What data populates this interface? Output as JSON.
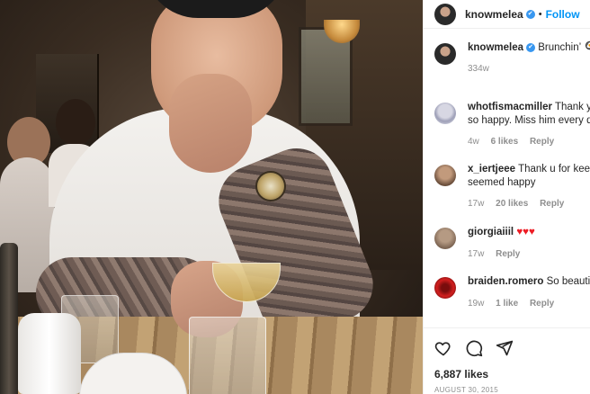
{
  "post": {
    "author": "knowmelea",
    "follow_label": "Follow",
    "dot": "•",
    "verified_glyph": "✔",
    "caption_text": "Brunchin’",
    "caption_emoji": "🍳",
    "caption_time": "334w",
    "likes_count": "6,887 likes",
    "date": "AUGUST 30, 2015"
  },
  "comments": [
    {
      "user": "whotfismacmiller",
      "text_line1": "Thank you",
      "text_line2": "so happy. Miss him every day",
      "time": "4w",
      "likes": "6 likes",
      "reply": "Reply",
      "avatar": "cartoon-avatar"
    },
    {
      "user": "x_iertjeee",
      "text_line1": "Thank u for keepin",
      "text_line2": "seemed happy",
      "time": "17w",
      "likes": "20 likes",
      "reply": "Reply",
      "avatar": "person-avatar"
    },
    {
      "user": "giorgiaiiil",
      "text_line1": "♥♥♥",
      "time": "17w",
      "reply": "Reply",
      "avatar": "person-avatar"
    },
    {
      "user": "braiden.romero",
      "text_line1": "So beautiful",
      "time": "19w",
      "likes": "1 like",
      "reply": "Reply",
      "avatar": "red-logo-avatar"
    }
  ],
  "icons": [
    "heart-icon",
    "comment-icon",
    "share-icon"
  ],
  "colors": {
    "accent": "#0095f6",
    "verified": "#3897f0",
    "muted": "#8e8e8e",
    "heart": "#ed1c24"
  }
}
